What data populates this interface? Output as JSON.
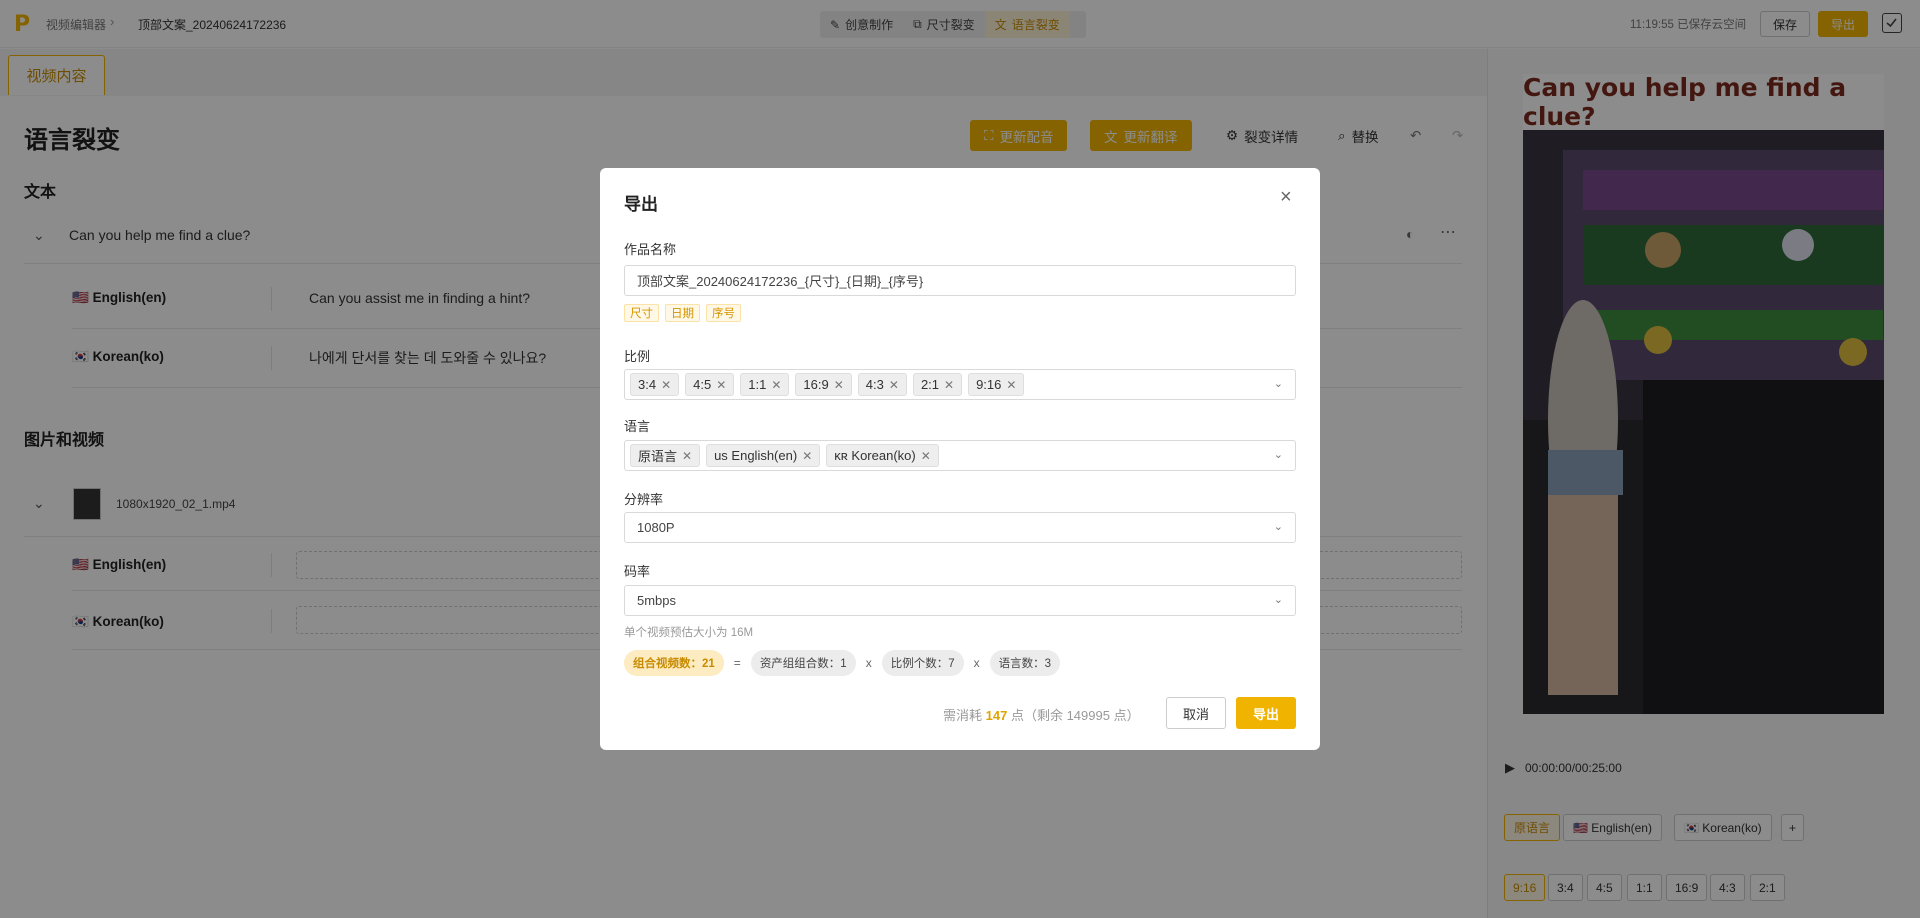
{
  "topbar": {
    "logo": "P",
    "breadcrumb_root": "视频编辑器",
    "breadcrumb_sep": "›",
    "breadcrumb_current": "顶部文案_20240624172236",
    "tabs": [
      {
        "label": "创意制作",
        "icon": "✎"
      },
      {
        "label": "尺寸裂变",
        "icon": "⧉"
      },
      {
        "label": "语言裂变",
        "icon": "文"
      }
    ],
    "saved_status": "11:19:55 已保存云空间",
    "save_label": "保存",
    "export_label": "导出"
  },
  "workspace": {
    "tab_label": "视频内容",
    "title": "语言裂变",
    "toolbar": {
      "update_voice": "更新配音",
      "update_translation": "更新翻译",
      "details": "裂变详情",
      "replace": "替换"
    },
    "text_section": "文本",
    "source_text": "Can you help me find a clue?",
    "translations": [
      {
        "flag": "🇺🇸",
        "lang": "English(en)",
        "text": "Can you assist me in finding a hint?"
      },
      {
        "flag": "🇰🇷",
        "lang": "Korean(ko)",
        "text": "나에게 단서를 찾는 데 도와줄 수 있나요?"
      }
    ],
    "media_section": "图片和视频",
    "media_file": "1080x1920_02_1.mp4",
    "media_langs": [
      {
        "flag": "🇺🇸",
        "lang": "English(en)"
      },
      {
        "flag": "🇰🇷",
        "lang": "Korean(ko)"
      }
    ]
  },
  "preview": {
    "caption": "Can you help me find a clue?",
    "time": "00:00:00/00:25:00",
    "lang_chips": [
      "原语言",
      "🇺🇸 English(en)",
      "🇰🇷 Korean(ko)",
      "+"
    ],
    "ratio_chips": [
      "9:16",
      "3:4",
      "4:5",
      "1:1",
      "16:9",
      "4:3",
      "2:1"
    ]
  },
  "modal": {
    "title": "导出",
    "close": "×",
    "name_label": "作品名称",
    "name_value": "顶部文案_20240624172236_{尺寸}_{日期}_{序号}",
    "name_vars": [
      "尺寸",
      "日期",
      "序号"
    ],
    "ratio_label": "比例",
    "ratios": [
      "3:4",
      "4:5",
      "1:1",
      "16:9",
      "4:3",
      "2:1",
      "9:16"
    ],
    "lang_label": "语言",
    "languages": [
      "原语言",
      "us English(en)",
      "ĸʀ Korean(ko)"
    ],
    "resolution_label": "分辨率",
    "resolution_value": "1080P",
    "bitrate_label": "码率",
    "bitrate_value": "5mbps",
    "size_hint": "单个视频预估大小为 16M",
    "formula": {
      "total": "组合视频数：21",
      "eq": "=",
      "assets": "资产组组合数：1",
      "x1": "x",
      "ratios": "比例个数：7",
      "x2": "x",
      "langs": "语言数：3"
    },
    "cost_prefix": "需消耗",
    "cost_value": "147",
    "cost_suffix": "点（剩余 149995 点）",
    "cancel_label": "取消",
    "export_label": "导出"
  },
  "colors": {
    "accent": "#f0b400",
    "accent_text": "#c88c00"
  }
}
